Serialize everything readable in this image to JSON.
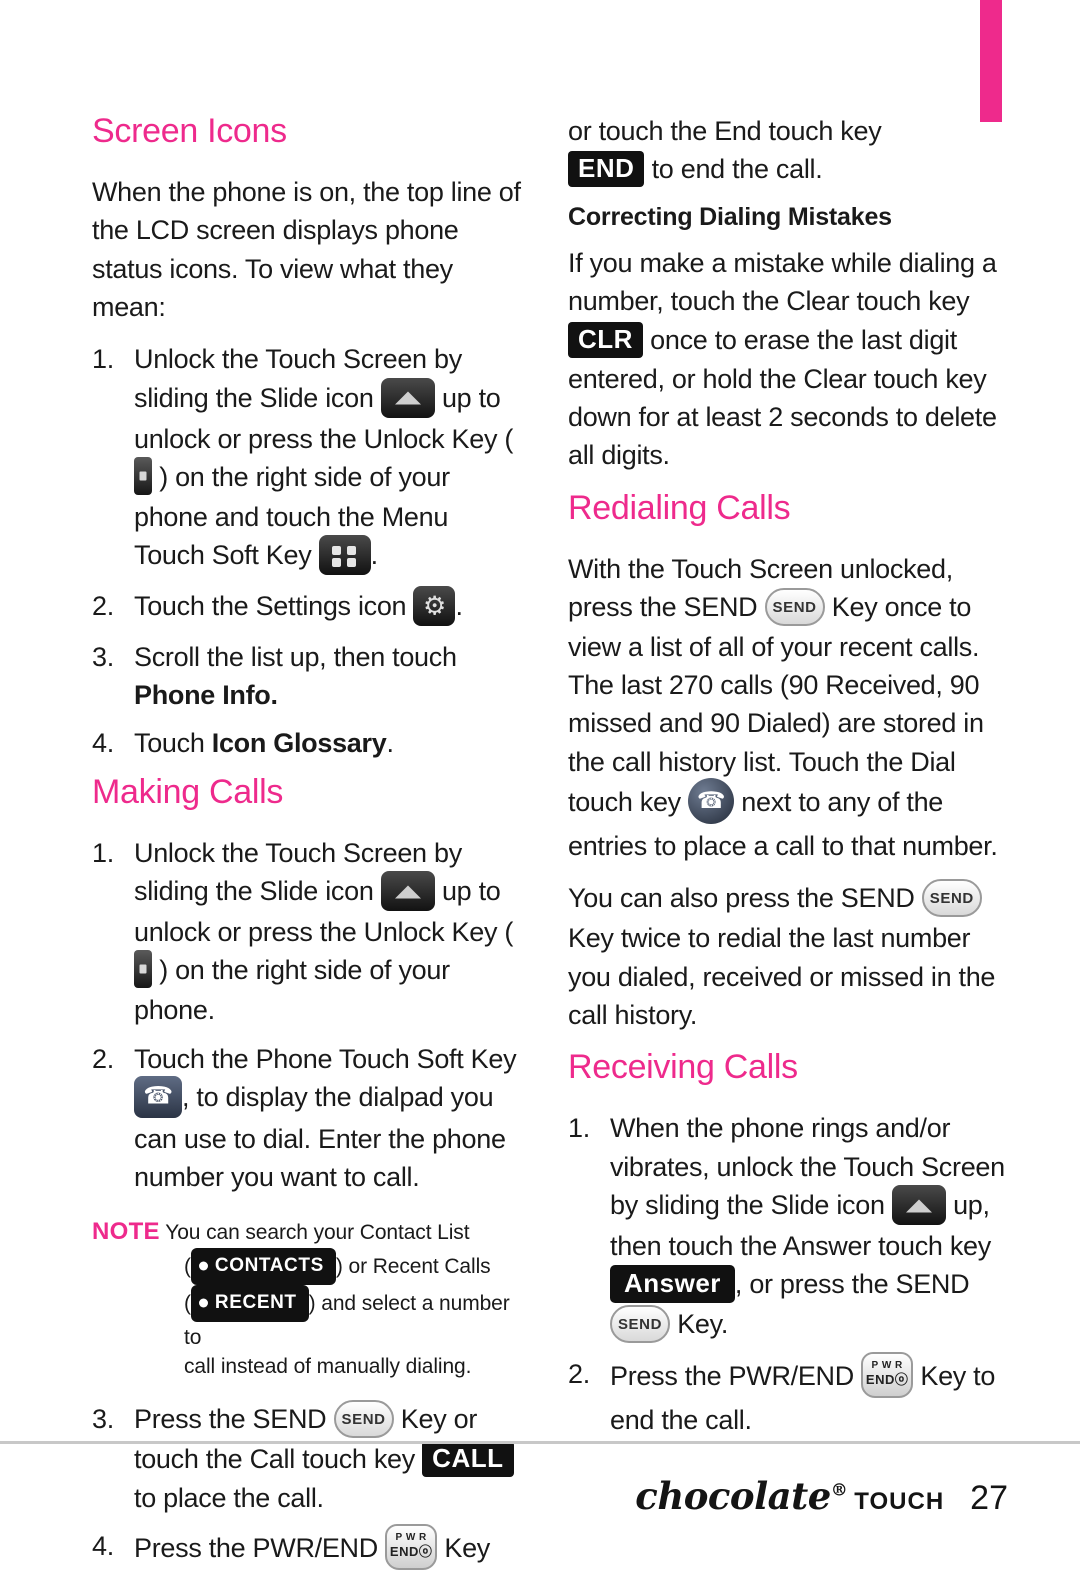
{
  "page": {
    "number": "27",
    "brand": "chocolate",
    "brand_reg": "®",
    "brand_sub": "TOUCH"
  },
  "left": {
    "heading1": "Screen Icons",
    "intro": "When the phone is on, the top line of the LCD screen displays phone status icons. To view what they mean:",
    "steps1": [
      {
        "num": "1.",
        "part1": "Unlock the Touch Screen by sliding the Slide icon",
        "part2": "up to unlock or press the Unlock Key (",
        "part3": ") on the right side of your phone and touch the Menu Touch Soft Key",
        "part4": "."
      },
      {
        "num": "2.",
        "part1": "Touch the Settings icon",
        "part2": "."
      },
      {
        "num": "3.",
        "part1": "Scroll the list up, then touch",
        "bold": "Phone Info",
        "part2": "."
      },
      {
        "num": "4.",
        "part1": "Touch",
        "bold": "Icon Glossary",
        "part2": "."
      }
    ],
    "heading2": "Making Calls",
    "steps2": [
      {
        "num": "1.",
        "part1": "Unlock the Touch Screen by sliding the Slide icon",
        "part2": "up to unlock or press the Unlock Key (",
        "part3": ") on the right side of your phone."
      },
      {
        "num": "2.",
        "part1": "Touch the Phone Touch Soft Key",
        "part2": ", to display the dialpad you can use to dial. Enter the phone number you want to call."
      },
      {
        "num": "3.",
        "part1": "Press the SEND",
        "part2": "Key or touch the Call touch key",
        "key_call": "CALL",
        "part3": "to place the call."
      },
      {
        "num": "4.",
        "part1": "Press the PWR/END",
        "part2": "Key"
      }
    ],
    "note": {
      "label": "NOTE",
      "line1": "You can search your Contact List",
      "line2_pre": "(",
      "contacts_chip": "CONTACTS",
      "line2_post": ") or Recent Calls",
      "line3_pre": "(",
      "recent_chip": "RECENT",
      "line3_post": ") and select a number to",
      "line4": "call instead of manually dialing."
    }
  },
  "right": {
    "cont_line1": "or touch the End touch key",
    "end_key": "END",
    "cont_line2": "to end the call.",
    "subheading1": "Correcting Dialing Mistakes",
    "para1_a": "If you make a mistake while dialing a number, touch the Clear touch key",
    "clr_key": "CLR",
    "para1_b": "once to erase the last digit entered, or hold the Clear touch key down for at least 2 seconds to delete all digits.",
    "heading1": "Redialing Calls",
    "para2_a": "With the Touch Screen unlocked, press the SEND",
    "para2_b": "Key once to view a list of all of your recent calls. The last 270 calls (90 Received, 90 missed and 90 Dialed) are stored in the call history list. Touch the Dial touch key",
    "para2_c": "next to any of the entries to place a call to that number.",
    "para3_a": "You can also press the SEND",
    "para3_b": "Key twice to redial the last number you dialed, received or missed in the call history.",
    "heading2": "Receiving Calls",
    "steps": [
      {
        "num": "1.",
        "part1": "When the phone rings and/or vibrates, unlock the Touch Screen by sliding the Slide icon",
        "part2": "up, then touch the Answer touch key",
        "answer_key": "Answer",
        "part3": ", or press the SEND",
        "part4": "Key."
      },
      {
        "num": "2.",
        "part1": "Press the PWR/END",
        "part2": "Key to end the call."
      }
    ]
  },
  "keys": {
    "send_label": "SEND",
    "pwr_line1": "P W R",
    "pwr_line2": "ENDⓞ"
  },
  "colors": {
    "accent": "#ee2a8c",
    "text": "#1a1a1a",
    "rule": "#c8c8c8"
  }
}
